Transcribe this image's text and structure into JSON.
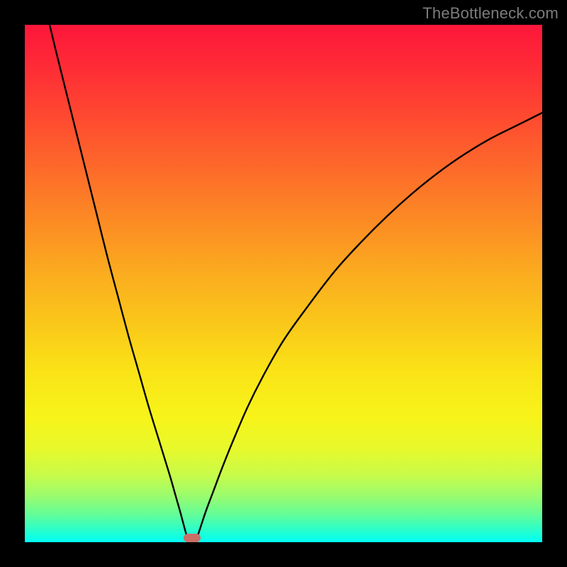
{
  "watermark": "TheBottleneck.com",
  "colors": {
    "frame": "#000000",
    "watermark_text": "#7c7c7c",
    "curve_stroke": "#000000",
    "marker": "#cb6e66",
    "gradient_top": "#fd163a",
    "gradient_bottom": "#02fff8"
  },
  "chart_data": {
    "type": "line",
    "title": "",
    "xlabel": "",
    "ylabel": "",
    "xlim": [
      0,
      100
    ],
    "ylim": [
      0,
      100
    ],
    "series": [
      {
        "name": "left-branch",
        "x": [
          4.8,
          6,
          8,
          10,
          12,
          14,
          16,
          18,
          20,
          22,
          24,
          26,
          28,
          29,
          30,
          30.8,
          31.3
        ],
        "values": [
          100,
          95,
          87,
          79,
          71,
          63,
          55,
          47.5,
          40,
          33,
          26,
          19.5,
          13,
          9.5,
          6,
          3,
          1.2
        ]
      },
      {
        "name": "right-branch",
        "x": [
          33.4,
          34,
          35,
          36.5,
          38,
          40,
          43,
          46,
          50,
          55,
          60,
          65,
          70,
          75,
          80,
          85,
          90,
          95,
          100
        ],
        "values": [
          1.2,
          3,
          6,
          10,
          14,
          19,
          26,
          32,
          39,
          46,
          52.5,
          58,
          63,
          67.5,
          71.5,
          75,
          78,
          80.5,
          83
        ]
      }
    ],
    "marker": {
      "x": 32.3,
      "y": 0.8,
      "shape": "rounded-rect"
    },
    "grid": false,
    "legend": false,
    "annotations": []
  }
}
